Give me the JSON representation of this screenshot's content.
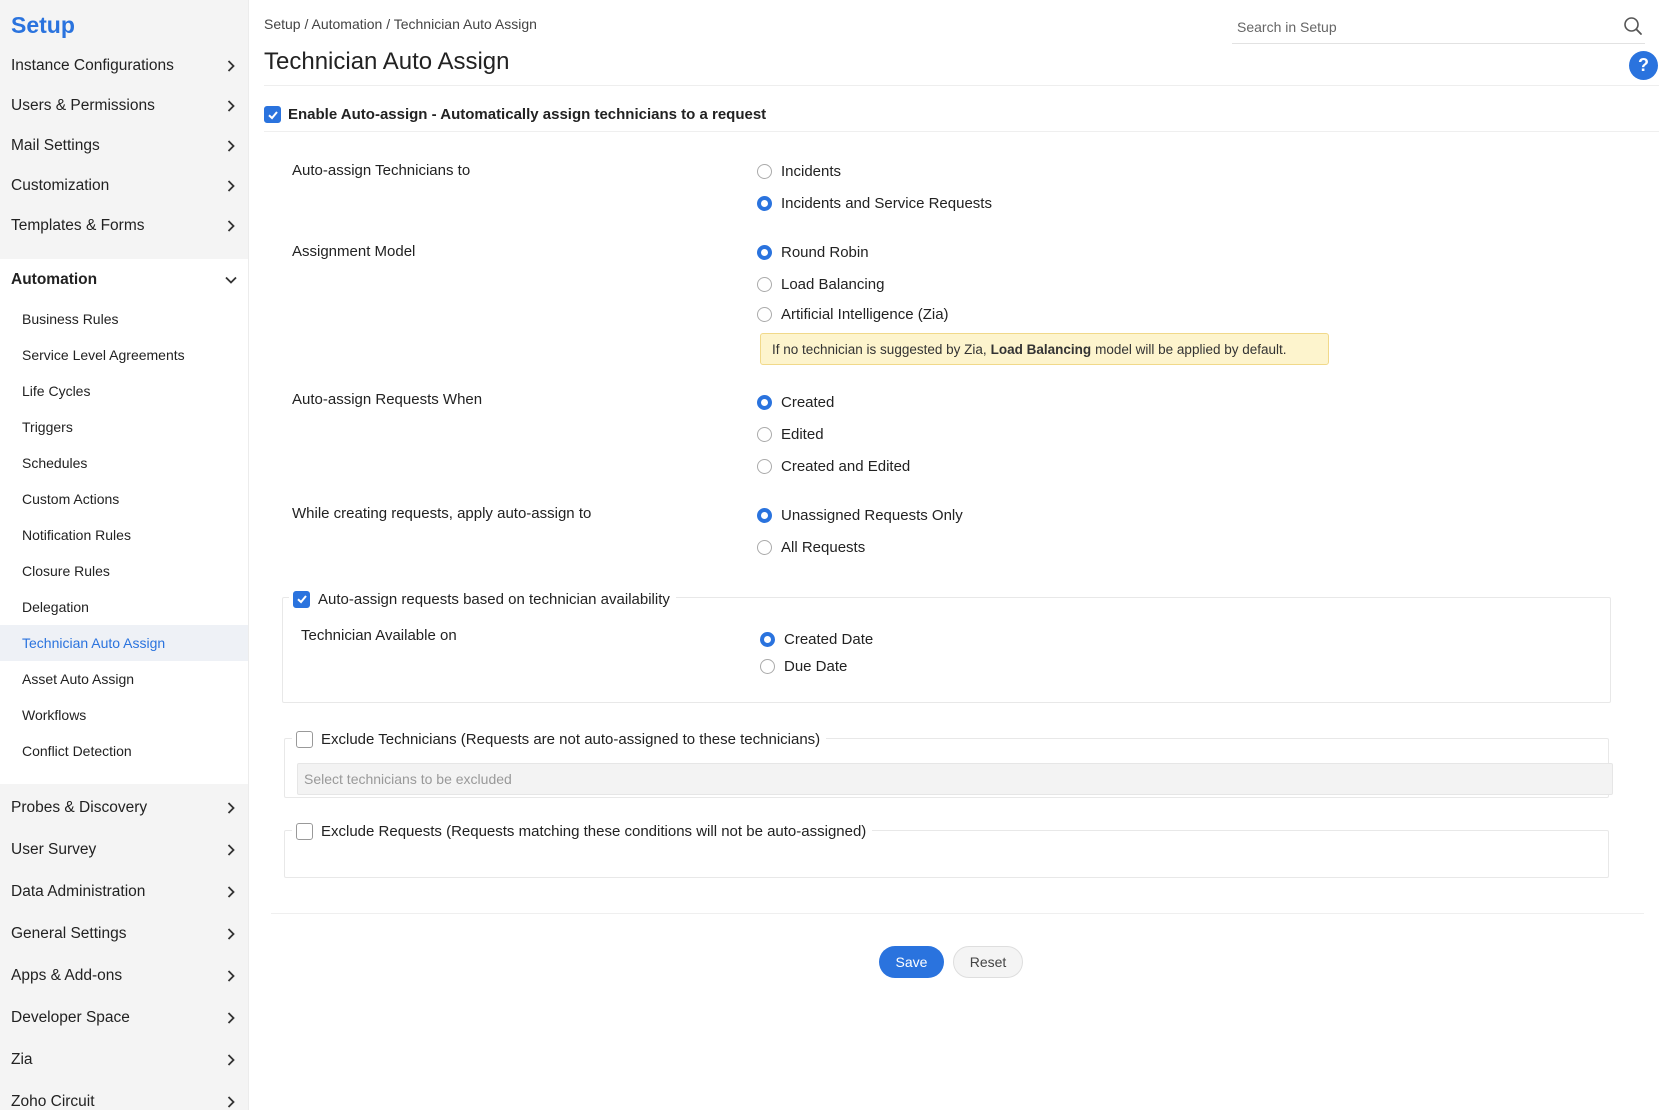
{
  "sidebar": {
    "title": "Setup",
    "items": [
      {
        "label": "Instance Configurations"
      },
      {
        "label": "Users & Permissions"
      },
      {
        "label": "Mail Settings"
      },
      {
        "label": "Customization"
      },
      {
        "label": "Templates & Forms"
      },
      {
        "label": "Automation"
      },
      {
        "label": "Probes & Discovery"
      },
      {
        "label": "User Survey"
      },
      {
        "label": "Data Administration"
      },
      {
        "label": "General Settings"
      },
      {
        "label": "Apps & Add-ons"
      },
      {
        "label": "Developer Space"
      },
      {
        "label": "Zia"
      },
      {
        "label": "Zoho Circuit"
      }
    ],
    "automation_sub": [
      {
        "label": "Business Rules"
      },
      {
        "label": "Service Level Agreements"
      },
      {
        "label": "Life Cycles"
      },
      {
        "label": "Triggers"
      },
      {
        "label": "Schedules"
      },
      {
        "label": "Custom Actions"
      },
      {
        "label": "Notification Rules"
      },
      {
        "label": "Closure Rules"
      },
      {
        "label": "Delegation"
      },
      {
        "label": "Technician Auto Assign"
      },
      {
        "label": "Asset Auto Assign"
      },
      {
        "label": "Workflows"
      },
      {
        "label": "Conflict Detection"
      }
    ],
    "active_item": "Technician Auto Assign"
  },
  "header": {
    "breadcrumb": "Setup / Automation / Technician Auto Assign",
    "search_placeholder": "Search in Setup",
    "help_symbol": "?"
  },
  "page": {
    "title": "Technician Auto Assign",
    "enable_label": "Enable Auto-assign - Automatically assign technicians to a request",
    "enable_checked": true
  },
  "form": {
    "assign_to": {
      "label": "Auto-assign Technicians to",
      "options": [
        "Incidents",
        "Incidents and Service Requests"
      ],
      "selected": "Incidents and Service Requests"
    },
    "model": {
      "label": "Assignment Model",
      "options": [
        "Round Robin",
        "Load Balancing",
        "Artificial Intelligence (Zia)"
      ],
      "selected": "Round Robin",
      "note_before": "If no technician is suggested by Zia,",
      "note_bold": "Load Balancing",
      "note_after": "model will be applied by default."
    },
    "when": {
      "label": "Auto-assign Requests When",
      "options": [
        "Created",
        "Edited",
        "Created and Edited"
      ],
      "selected": "Created"
    },
    "apply_to": {
      "label": "While creating requests, apply auto-assign to",
      "options": [
        "Unassigned Requests Only",
        "All Requests"
      ],
      "selected": "Unassigned Requests Only"
    },
    "availability": {
      "label": "Auto-assign requests based on technician availability",
      "checked": true,
      "field_label": "Technician Available on",
      "options": [
        "Created Date",
        "Due Date"
      ],
      "selected": "Created Date"
    },
    "exclude_technicians": {
      "label": "Exclude Technicians (Requests are not auto-assigned to these technicians)",
      "checked": false,
      "placeholder": "Select technicians to be excluded"
    },
    "exclude_requests": {
      "label": "Exclude Requests (Requests matching these conditions will not be auto-assigned)",
      "checked": false
    }
  },
  "actions": {
    "save": "Save",
    "reset": "Reset"
  },
  "colors": {
    "accent": "#2a73de",
    "note_bg": "#fdf4cd"
  }
}
